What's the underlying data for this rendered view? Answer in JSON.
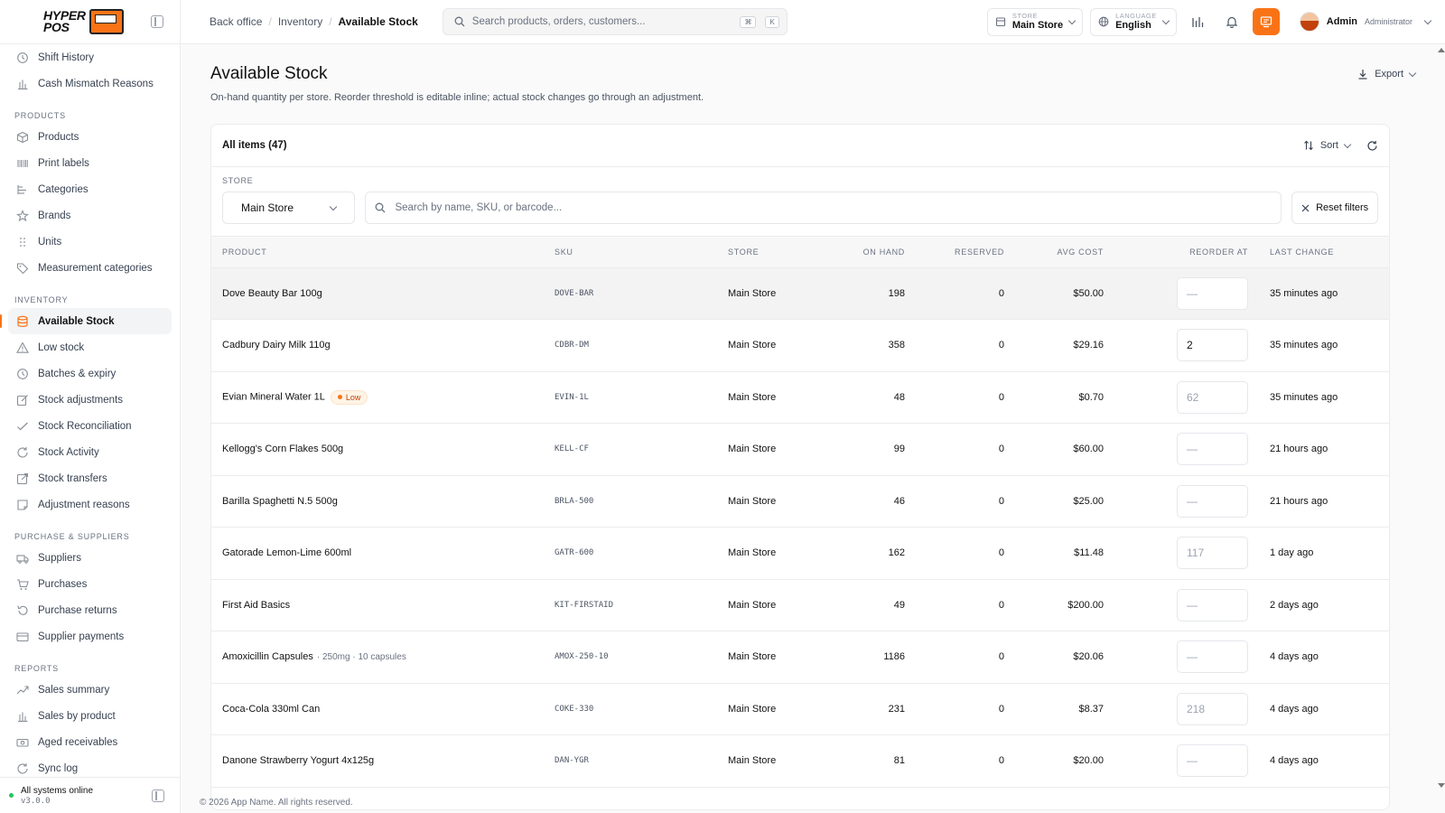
{
  "brand": {
    "line1": "HYPER",
    "line2": "POS"
  },
  "breadcrumb": [
    "Back office",
    "Inventory",
    "Available Stock"
  ],
  "search": {
    "placeholder": "Search products, orders, customers...",
    "kbd1": "⌘",
    "kbd2": "K"
  },
  "store_select": {
    "label": "STORE",
    "value": "Main Store"
  },
  "language_select": {
    "label": "LANGUAGE",
    "value": "English"
  },
  "user": {
    "name": "Admin",
    "role": "Administrator"
  },
  "sidebar": {
    "top_items": [
      {
        "label": "Shift History",
        "icon": "clock-icon"
      },
      {
        "label": "Cash Mismatch Reasons",
        "icon": "bar-chart-icon"
      }
    ],
    "sections": [
      {
        "title": "PRODUCTS",
        "items": [
          {
            "label": "Products",
            "icon": "box-icon"
          },
          {
            "label": "Print labels",
            "icon": "barcode-icon"
          },
          {
            "label": "Categories",
            "icon": "tree-icon"
          },
          {
            "label": "Brands",
            "icon": "star-icon"
          },
          {
            "label": "Units",
            "icon": "grip-icon"
          },
          {
            "label": "Measurement categories",
            "icon": "tag-icon"
          }
        ]
      },
      {
        "title": "INVENTORY",
        "items": [
          {
            "label": "Available Stock",
            "icon": "database-icon",
            "active": true
          },
          {
            "label": "Low stock",
            "icon": "warning-icon"
          },
          {
            "label": "Batches & expiry",
            "icon": "clock-icon"
          },
          {
            "label": "Stock adjustments",
            "icon": "edit-icon"
          },
          {
            "label": "Stock Reconciliation",
            "icon": "check-icon"
          },
          {
            "label": "Stock Activity",
            "icon": "refresh-icon"
          },
          {
            "label": "Stock transfers",
            "icon": "external-icon"
          },
          {
            "label": "Adjustment reasons",
            "icon": "note-icon"
          }
        ]
      },
      {
        "title": "PURCHASE & SUPPLIERS",
        "items": [
          {
            "label": "Suppliers",
            "icon": "truck-icon"
          },
          {
            "label": "Purchases",
            "icon": "cart-icon"
          },
          {
            "label": "Purchase returns",
            "icon": "undo-icon"
          },
          {
            "label": "Supplier payments",
            "icon": "card-icon"
          }
        ]
      },
      {
        "title": "REPORTS",
        "items": [
          {
            "label": "Sales summary",
            "icon": "trend-icon"
          },
          {
            "label": "Sales by product",
            "icon": "bar-chart-icon"
          },
          {
            "label": "Aged receivables",
            "icon": "cash-icon"
          },
          {
            "label": "Sync log",
            "icon": "refresh-icon"
          }
        ]
      }
    ],
    "footer": {
      "status": "All systems online",
      "version": "v3.0.0"
    }
  },
  "page": {
    "title": "Available Stock",
    "subtitle": "On-hand quantity per store. Reorder threshold is editable inline; actual stock changes go through an adjustment.",
    "export_label": "Export"
  },
  "card": {
    "title": "All items (47)",
    "sort_label": "Sort",
    "filter_label": "STORE",
    "store_value": "Main Store",
    "search_placeholder": "Search by name, SKU, or barcode...",
    "reset_label": "Reset filters"
  },
  "table": {
    "columns": [
      "PRODUCT",
      "SKU",
      "STORE",
      "ON HAND",
      "RESERVED",
      "AVG COST",
      "REORDER AT",
      "LAST CHANGE"
    ],
    "rows": [
      {
        "product": "Dove Beauty Bar 100g",
        "variant": "",
        "low": "",
        "sku": "DOVE-BAR",
        "store": "Main Store",
        "on_hand": "198",
        "reserved": "0",
        "avg_cost": "$50.00",
        "reorder": "—",
        "reorder_filled": false,
        "last_change": "35 minutes ago"
      },
      {
        "product": "Cadbury Dairy Milk 110g",
        "variant": "",
        "low": "",
        "sku": "CDBR-DM",
        "store": "Main Store",
        "on_hand": "358",
        "reserved": "0",
        "avg_cost": "$29.16",
        "reorder": "2",
        "reorder_filled": true,
        "last_change": "35 minutes ago"
      },
      {
        "product": "Evian Mineral Water 1L",
        "variant": "",
        "low": "Low",
        "sku": "EVIN-1L",
        "store": "Main Store",
        "on_hand": "48",
        "reserved": "0",
        "avg_cost": "$0.70",
        "reorder": "62",
        "reorder_filled": false,
        "last_change": "35 minutes ago"
      },
      {
        "product": "Kellogg's Corn Flakes 500g",
        "variant": "",
        "low": "",
        "sku": "KELL-CF",
        "store": "Main Store",
        "on_hand": "99",
        "reserved": "0",
        "avg_cost": "$60.00",
        "reorder": "—",
        "reorder_filled": false,
        "last_change": "21 hours ago"
      },
      {
        "product": "Barilla Spaghetti N.5 500g",
        "variant": "",
        "low": "",
        "sku": "BRLA-500",
        "store": "Main Store",
        "on_hand": "46",
        "reserved": "0",
        "avg_cost": "$25.00",
        "reorder": "—",
        "reorder_filled": false,
        "last_change": "21 hours ago"
      },
      {
        "product": "Gatorade Lemon-Lime 600ml",
        "variant": "",
        "low": "",
        "sku": "GATR-600",
        "store": "Main Store",
        "on_hand": "162",
        "reserved": "0",
        "avg_cost": "$11.48",
        "reorder": "117",
        "reorder_filled": false,
        "last_change": "1 day ago"
      },
      {
        "product": "First Aid Basics",
        "variant": "",
        "low": "",
        "sku": "KIT-FIRSTAID",
        "store": "Main Store",
        "on_hand": "49",
        "reserved": "0",
        "avg_cost": "$200.00",
        "reorder": "—",
        "reorder_filled": false,
        "last_change": "2 days ago"
      },
      {
        "product": "Amoxicillin Capsules",
        "variant": "· 250mg · 10 capsules",
        "low": "",
        "sku": "AMOX-250-10",
        "store": "Main Store",
        "on_hand": "1186",
        "reserved": "0",
        "avg_cost": "$20.06",
        "reorder": "—",
        "reorder_filled": false,
        "last_change": "4 days ago"
      },
      {
        "product": "Coca-Cola 330ml Can",
        "variant": "",
        "low": "",
        "sku": "COKE-330",
        "store": "Main Store",
        "on_hand": "231",
        "reserved": "0",
        "avg_cost": "$8.37",
        "reorder": "218",
        "reorder_filled": false,
        "last_change": "4 days ago"
      },
      {
        "product": "Danone Strawberry Yogurt 4x125g",
        "variant": "",
        "low": "",
        "sku": "DAN-YGR",
        "store": "Main Store",
        "on_hand": "81",
        "reserved": "0",
        "avg_cost": "$20.00",
        "reorder": "—",
        "reorder_filled": false,
        "last_change": "4 days ago"
      }
    ]
  },
  "footer": {
    "text": "© 2026 App Name. All rights reserved."
  },
  "colors": {
    "accent": "#f97316",
    "online": "#22c55e"
  }
}
